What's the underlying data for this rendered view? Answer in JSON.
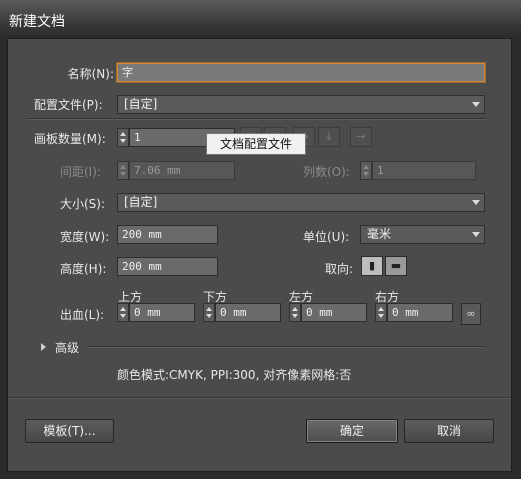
{
  "window": {
    "title": "新建文档"
  },
  "form": {
    "name_label": "名称(N):",
    "name_value": "字",
    "profile_label": "配置文件(P):",
    "profile_value": "[自定]",
    "artboards_label": "画板数量(M):",
    "artboards_value": "1",
    "spacing_label": "间距(I):",
    "spacing_value": "7.06 mm",
    "columns_label": "列数(O):",
    "columns_value": "1",
    "size_label": "大小(S):",
    "size_value": "[自定]",
    "width_label": "宽度(W):",
    "width_value": "200 mm",
    "units_label": "单位(U):",
    "units_value": "毫米",
    "height_label": "高度(H):",
    "height_value": "200 mm",
    "orientation_label": "取向:",
    "bleed_label": "出血(L):",
    "bleed": {
      "top_label": "上方",
      "top_value": "0 mm",
      "bottom_label": "下方",
      "bottom_value": "0 mm",
      "left_label": "左方",
      "left_value": "0 mm",
      "right_label": "右方",
      "right_value": "0 mm"
    },
    "advanced_label": "高级",
    "summary": "颜色模式:CMYK, PPI:300, 对齐像素网格:否"
  },
  "tooltip": {
    "text": "文档配置文件"
  },
  "buttons": {
    "templates": "模板(T)...",
    "ok": "确定",
    "cancel": "取消"
  },
  "icons": {
    "orientation": [
      "portrait-icon",
      "landscape-icon"
    ],
    "arrange": [
      "grid-by-row-icon",
      "grid-by-column-icon",
      "arrange-by-row-icon",
      "arrange-by-column-icon",
      "right-to-left-icon"
    ],
    "bleed_link": "link-icon"
  }
}
